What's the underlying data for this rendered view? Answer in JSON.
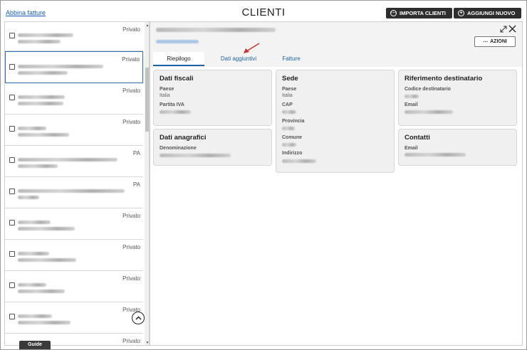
{
  "header": {
    "link_abbina": "Abbina fatture",
    "title": "CLIENTI",
    "btn_importa": "IMPORTA CLIENTI",
    "btn_aggiungi": "AGGIUNGI NUOVO"
  },
  "list": {
    "items": [
      {
        "type": "Privato"
      },
      {
        "type": "Privato"
      },
      {
        "type": "Privato"
      },
      {
        "type": "Privato"
      },
      {
        "type": "PA"
      },
      {
        "type": "PA"
      },
      {
        "type": "Privato"
      },
      {
        "type": "Privato"
      },
      {
        "type": "Privato"
      },
      {
        "type": "Privato"
      },
      {
        "type": "Privato"
      }
    ],
    "guide_label": "Guide"
  },
  "detail": {
    "azioni_label": "AZIONI",
    "tabs": [
      {
        "label": "Riepilogo"
      },
      {
        "label": "Dati aggiuntivi"
      },
      {
        "label": "Fatture"
      }
    ],
    "cards": {
      "dati_fiscali": {
        "title": "Dati fiscali",
        "paese_label": "Paese",
        "paese_value": "Italia",
        "piva_label": "Partita IVA"
      },
      "dati_anagrafici": {
        "title": "Dati anagrafici",
        "denominazione_label": "Denominazione"
      },
      "sede": {
        "title": "Sede",
        "paese_label": "Paese",
        "paese_value": "Italia",
        "cap_label": "CAP",
        "provincia_label": "Provincia",
        "comune_label": "Comune",
        "indirizzo_label": "Indirizzo"
      },
      "riferimento": {
        "title": "Riferimento destinatario",
        "codice_label": "Codice destinatario",
        "email_label": "Email"
      },
      "contatti": {
        "title": "Contatti",
        "email_label": "Email"
      }
    }
  },
  "colors": {
    "accent_blue": "#1e63b0",
    "dark_button": "#2e2e2e",
    "arrow_red": "#d0312d"
  }
}
